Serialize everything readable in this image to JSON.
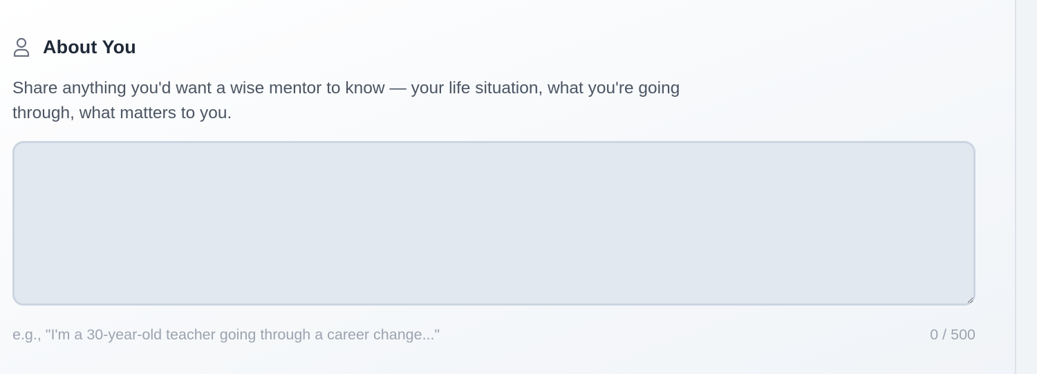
{
  "section": {
    "icon": "person-icon",
    "title": "About You",
    "description": "Share anything you'd want a wise mentor to know — your life situation, what you're going through, what matters to you.",
    "textarea": {
      "value": "",
      "placeholder": ""
    },
    "hint": "e.g., \"I'm a 30-year-old teacher going through a career change...\"",
    "counter": "0 / 500"
  },
  "colors": {
    "title": "#1f2937",
    "description": "#4b5563",
    "textarea_bg": "#e2e8f0",
    "textarea_border": "#cbd5e1",
    "hint": "#9ca3af"
  }
}
